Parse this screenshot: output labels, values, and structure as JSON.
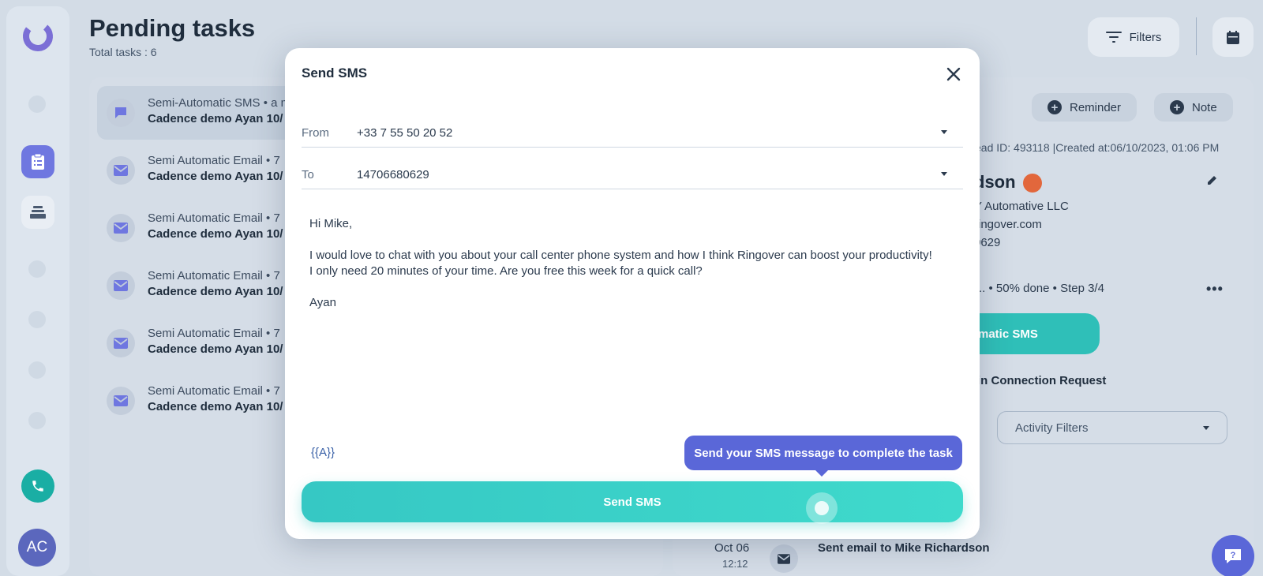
{
  "rail": {
    "avatar_initials": "AC"
  },
  "header": {
    "title": "Pending tasks",
    "subtitle": "Total tasks : 6",
    "filters_label": "Filters"
  },
  "tasks": [
    {
      "type": "Semi-Automatic SMS • a m",
      "name": "Cadence demo Ayan 10/",
      "icon": "chat-icon"
    },
    {
      "type": "Semi Automatic Email • 7",
      "name": "Cadence demo Ayan 10/",
      "icon": "mail-icon"
    },
    {
      "type": "Semi Automatic Email • 7",
      "name": "Cadence demo Ayan 10/",
      "icon": "mail-icon"
    },
    {
      "type": "Semi Automatic Email • 7",
      "name": "Cadence demo Ayan 10/",
      "icon": "mail-icon"
    },
    {
      "type": "Semi Automatic Email • 7",
      "name": "Cadence demo Ayan 10/",
      "icon": "mail-icon"
    },
    {
      "type": "Semi Automatic Email • 7",
      "name": "Cadence demo Ayan 10/",
      "icon": "mail-icon"
    }
  ],
  "detail": {
    "reminder_label": "Reminder",
    "note_label": "Note",
    "lead_meta": "ead ID: 493118 |Created at:06/10/2023, 01:06 PM",
    "lead_name": "dson",
    "company": "Y Automative LLC",
    "email": "ringover.com",
    "phone": "0629",
    "progress": ".. • 50% done • Step 3/4",
    "action_label": "matic SMS",
    "linkedin_text": "in Connection Request",
    "activity_filter": "Activity Filters",
    "activity_date": "Oct 06",
    "activity_time": "12:12",
    "activity_title": "Sent email to Mike Richardson"
  },
  "modal": {
    "title": "Send SMS",
    "from_label": "From",
    "from_value": "+33 7 55 50 20 52",
    "to_label": "To",
    "to_value": "14706680629",
    "body_lines": [
      "Hi Mike,",
      "I would love to chat with you about your call center phone system and how I think Ringover can boost your productivity!",
      "I only need 20 minutes of your time. Are you free this week for a quick call?",
      "Ayan"
    ],
    "variable_button": "{{A}}",
    "tooltip": "Send your SMS message to complete the task",
    "send_label": "Send SMS"
  }
}
